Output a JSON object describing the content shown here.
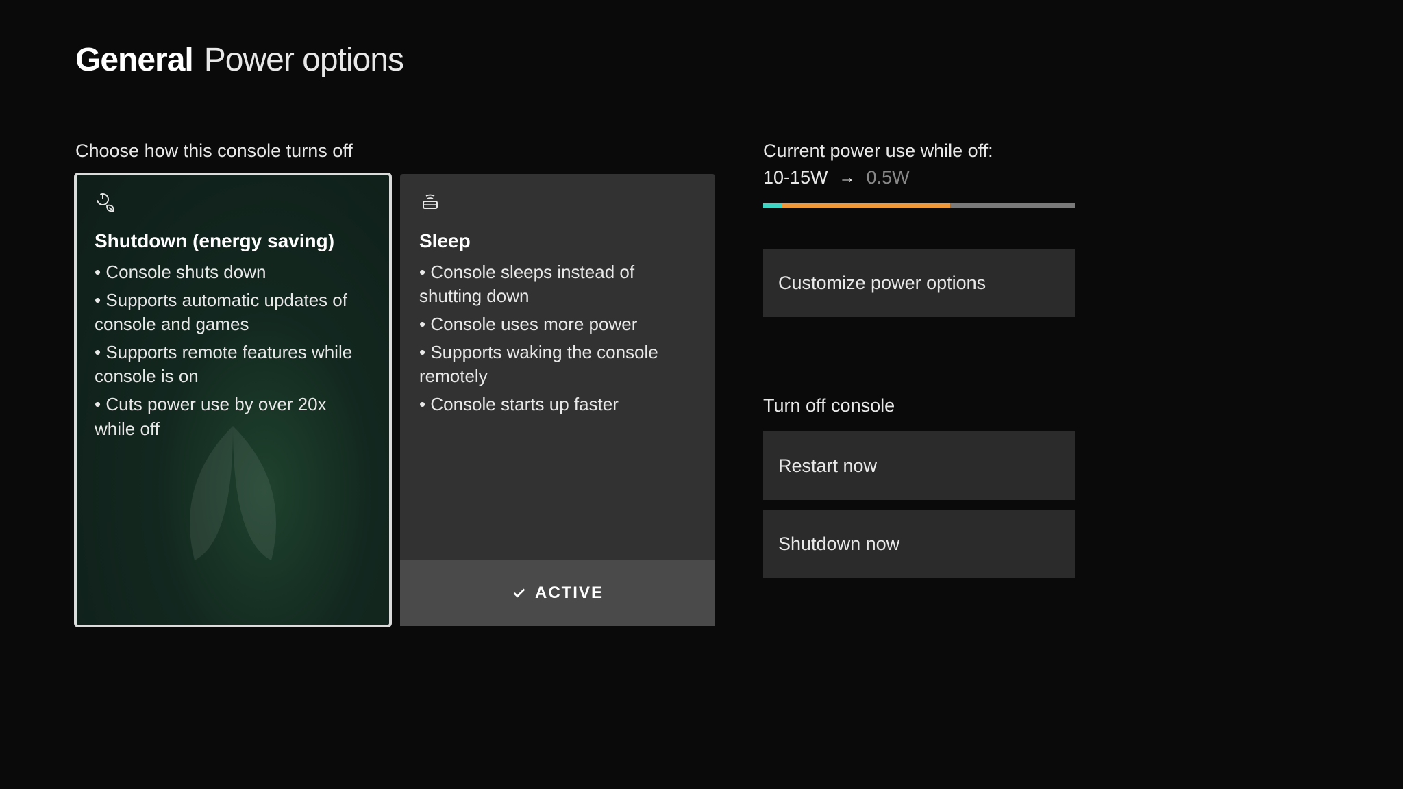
{
  "header": {
    "bold": "General",
    "light": "Power options"
  },
  "choose_label": "Choose how this console turns off",
  "cards": {
    "shutdown": {
      "title": "Shutdown (energy saving)",
      "bullets": [
        "• Console shuts down",
        "• Supports automatic updates of console and games",
        "• Supports remote features while console is on",
        "• Cuts power use by over 20x while off"
      ]
    },
    "sleep": {
      "title": "Sleep",
      "bullets": [
        "• Console sleeps instead of shutting down",
        "• Console uses more power",
        "• Supports waking the console remotely",
        "• Console starts up faster"
      ],
      "active_label": "ACTIVE"
    }
  },
  "right": {
    "power_use_label": "Current power use while off:",
    "power_from": "10-15W",
    "power_to": "0.5W",
    "customize_button": "Customize power options",
    "turn_off_label": "Turn off console",
    "restart_button": "Restart now",
    "shutdown_button": "Shutdown now"
  }
}
